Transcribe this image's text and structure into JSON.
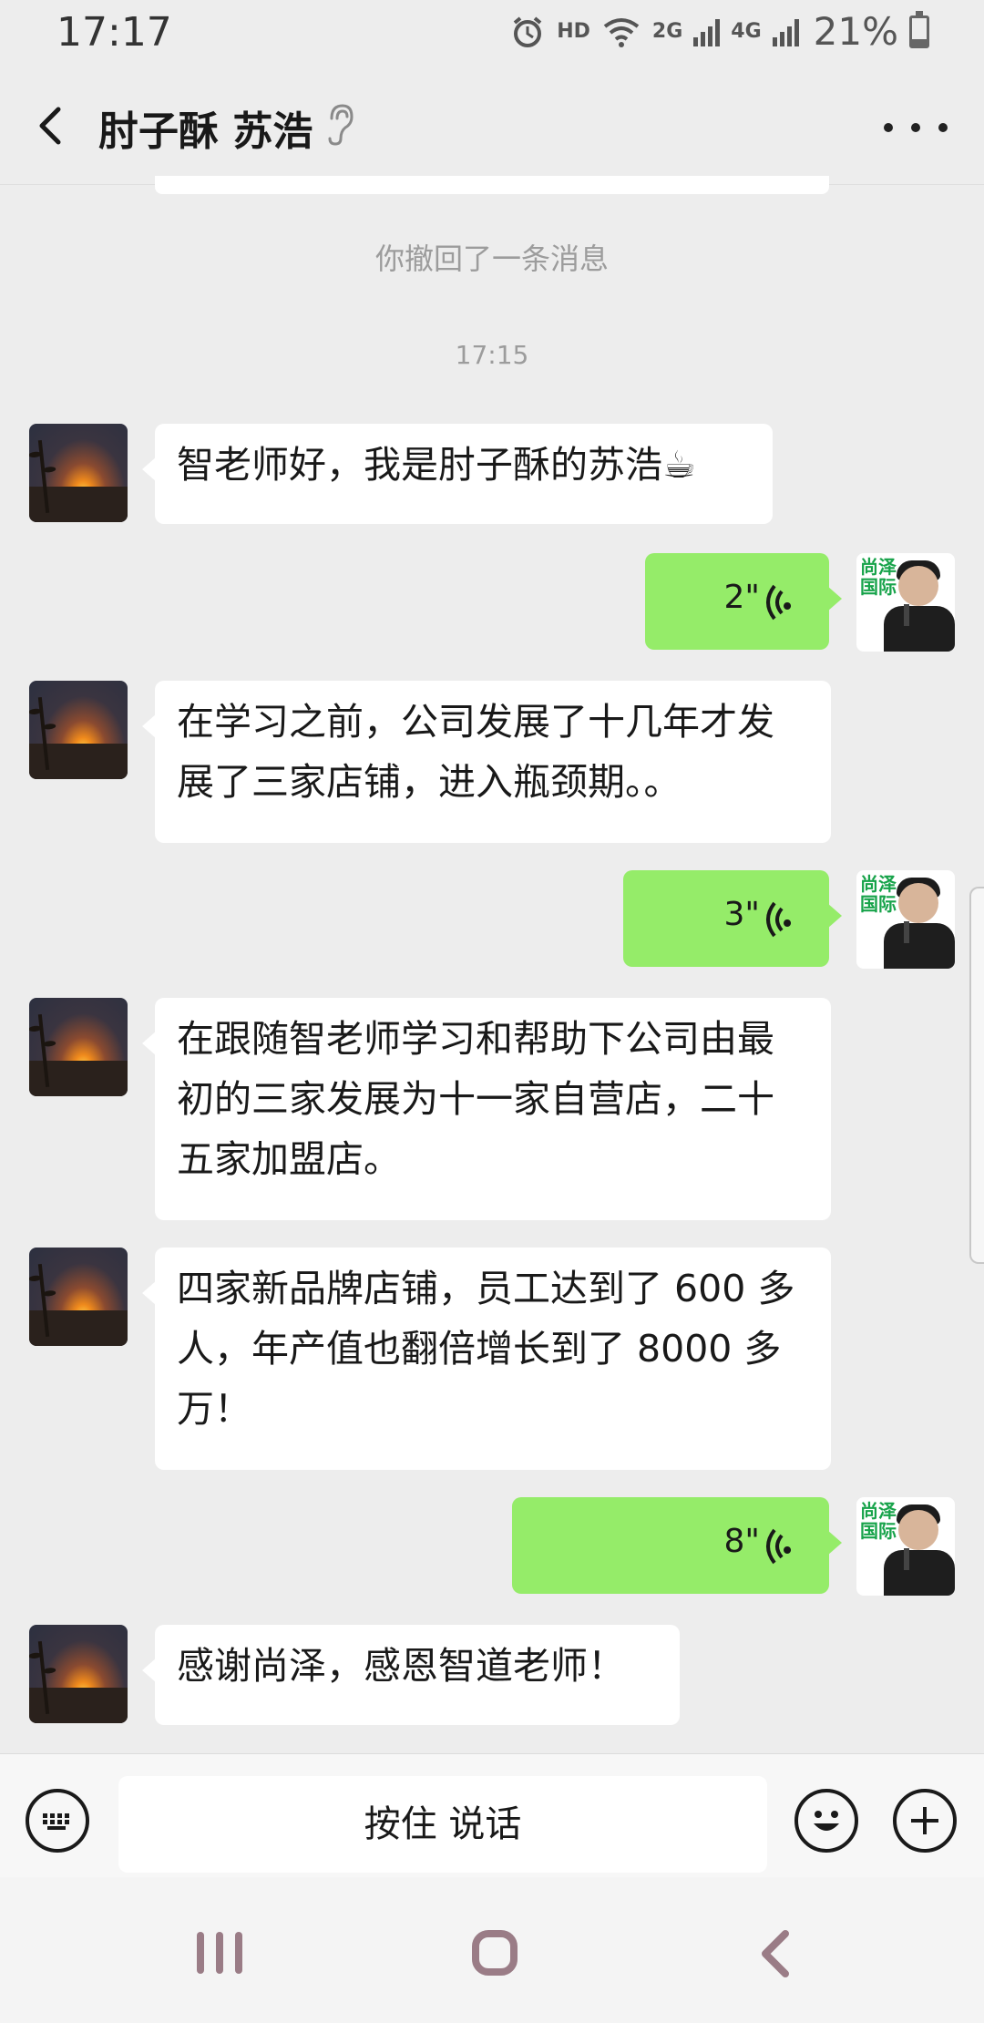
{
  "status_bar": {
    "time": "17:17",
    "hd": "HD",
    "net1": "2G",
    "net2": "4G",
    "battery_pct": "21%",
    "battery_level": 0.21
  },
  "header": {
    "title": "肘子酥 苏浩",
    "back_icon": "chevron-left-icon",
    "ear_icon": "ear-icon",
    "more_icon": "more-dots-icon"
  },
  "chat": {
    "system_recall": "你撤回了一条消息",
    "timestamp": "17:15",
    "messages": [
      {
        "side": "left",
        "type": "text",
        "text": "智老师好，我是肘子酥的苏浩☕"
      },
      {
        "side": "right",
        "type": "voice",
        "duration": "2\""
      },
      {
        "side": "left",
        "type": "text",
        "text": "在学习之前，公司发展了十几年才发展了三家店铺，进入瓶颈期。。"
      },
      {
        "side": "right",
        "type": "voice",
        "duration": "3\""
      },
      {
        "side": "left",
        "type": "text",
        "text": "在跟随智老师学习和帮助下公司由最初的三家发展为十一家自营店，二十五家加盟店。"
      },
      {
        "side": "left",
        "type": "text",
        "text": "四家新品牌店铺，员工达到了 600 多人，年产值也翻倍增长到了 8000 多万！"
      },
      {
        "side": "right",
        "type": "voice",
        "duration": "8\""
      },
      {
        "side": "left",
        "type": "text",
        "text": "感谢尚泽，感恩智道老师！"
      }
    ],
    "right_avatar_logo": "尚泽国际"
  },
  "input_bar": {
    "hold_to_talk": "按住 说话",
    "keyboard_icon": "keyboard-icon",
    "emoji_icon": "emoji-icon",
    "plus_icon": "plus-icon"
  },
  "nav_bar": {
    "recent_icon": "recent-apps-icon",
    "home_icon": "home-icon",
    "back_icon": "back-icon"
  }
}
